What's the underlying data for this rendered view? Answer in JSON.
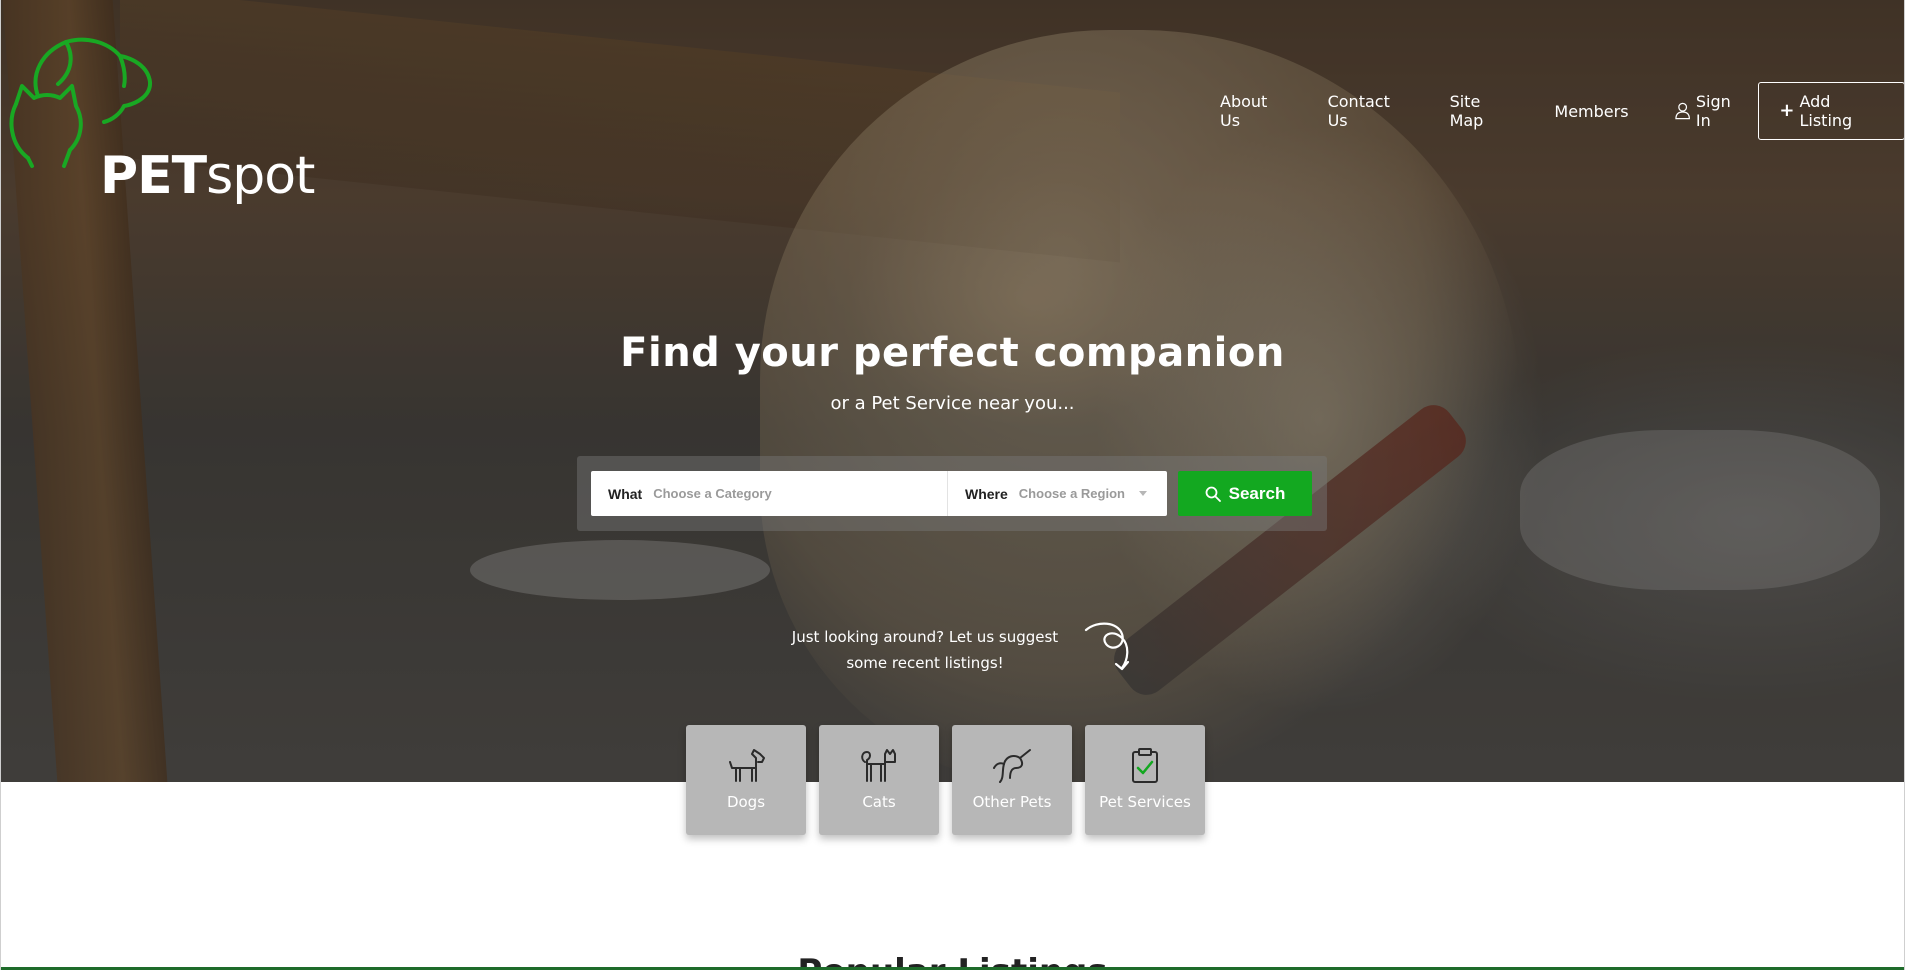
{
  "brand": {
    "name_bold": "PET",
    "name_light": "spot",
    "logo_icon": "dog-cat-outline-logo",
    "accent_color": "#13a820"
  },
  "nav": {
    "items": [
      {
        "label": "About Us"
      },
      {
        "label": "Contact Us"
      },
      {
        "label": "Site Map"
      },
      {
        "label": "Members"
      }
    ],
    "signin_label": "Sign In",
    "signin_icon": "user-icon",
    "add_listing_label": "Add Listing",
    "add_listing_icon": "plus-icon"
  },
  "hero": {
    "title": "Find your perfect companion",
    "subtitle": "or a Pet Service near you..."
  },
  "search": {
    "what_label": "What",
    "what_placeholder": "Choose a Category",
    "where_label": "Where",
    "where_value": "Choose a Region",
    "button_label": "Search",
    "button_icon": "search-icon",
    "button_color": "#13a820"
  },
  "suggest": {
    "text": "Just looking around? Let us suggest some recent listings!",
    "icon": "curly-arrow-icon"
  },
  "categories": [
    {
      "label": "Dogs",
      "icon": "dog-icon"
    },
    {
      "label": "Cats",
      "icon": "cat-icon"
    },
    {
      "label": "Other Pets",
      "icon": "unicorn-icon"
    },
    {
      "label": "Pet Services",
      "icon": "clipboard-check-icon"
    }
  ],
  "section": {
    "title": "Popular Listings"
  }
}
